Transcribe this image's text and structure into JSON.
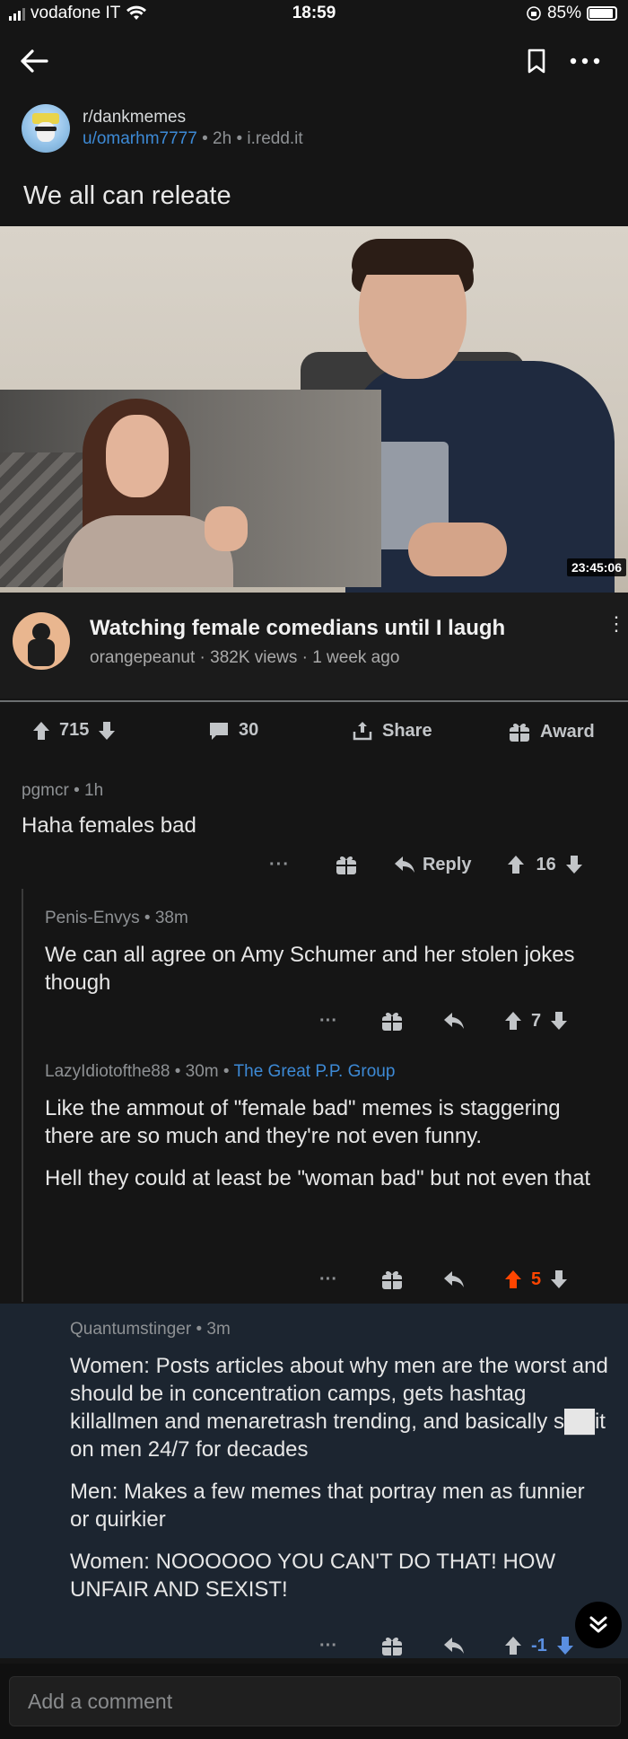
{
  "status_bar": {
    "carrier": "vodafone IT",
    "time": "18:59",
    "battery": "85%"
  },
  "post": {
    "subreddit": "r/dankmemes",
    "author": "u/omarhm7777",
    "age": "2h",
    "domain": "i.redd.it",
    "title": "We all can releate"
  },
  "video": {
    "duration": "23:45:06",
    "title": "Watching female comedians until I laugh",
    "channel_line": "orangepeanut · 382K views · 1 week ago"
  },
  "actions": {
    "upvotes": "715",
    "comments": "30",
    "share": "Share",
    "award": "Award"
  },
  "comments": [
    {
      "author": "pgmcr",
      "age": "1h",
      "body": [
        "Haha females bad"
      ],
      "reply": "Reply",
      "score": "16"
    },
    {
      "author": "Penis-Envys",
      "age": "38m",
      "body": [
        "We can all agree on Amy Schumer and her stolen jokes though"
      ],
      "score": "7"
    },
    {
      "author": "LazyIdiotofthe88",
      "age": "30m",
      "flair": "The Great P.P. Group",
      "body": [
        "Like the ammout of \"female bad\" memes is staggering there are so much and they're not even funny.",
        "Hell they could at least be \"woman bad\" but not even that"
      ],
      "score": "5"
    },
    {
      "author": "Quantumstinger",
      "age": "3m",
      "body": [
        "Women: Posts articles about why men are the worst and should be in concentration camps, gets hashtag killallmen and menaretrash trending, and basically s██it on men 24/7 for decades",
        "Men: Makes a few memes that portray men as funnier or quirkier",
        "Women: NOOOOOO YOU CAN'T DO THAT!  HOW UNFAIR AND SEXIST!"
      ],
      "score": "-1"
    }
  ],
  "add_comment_placeholder": "Add a comment",
  "colors": {
    "upvoted": "#ff4500",
    "link": "#3d8ad6",
    "highlight_bg": "#1c2530"
  }
}
